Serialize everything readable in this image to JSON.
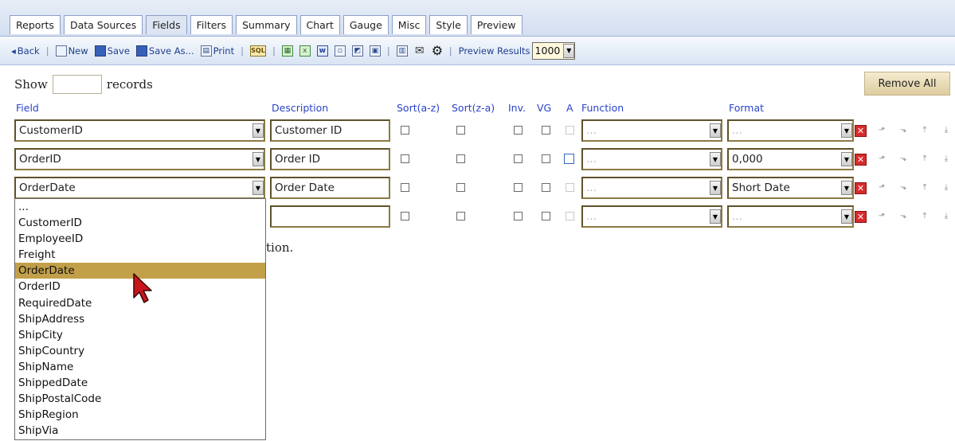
{
  "tabs": [
    "Reports",
    "Data Sources",
    "Fields",
    "Filters",
    "Summary",
    "Chart",
    "Gauge",
    "Misc",
    "Style",
    "Preview"
  ],
  "active_tab": "Fields",
  "toolbar": {
    "back": "Back",
    "new": "New",
    "save": "Save",
    "save_as": "Save As...",
    "print": "Print",
    "sql_icon": "SQL",
    "preview_results_label": "Preview Results",
    "preview_results_value": "1000"
  },
  "show": {
    "before": "Show",
    "after": "records",
    "value": ""
  },
  "remove_all": "Remove All",
  "headers": {
    "field": "Field",
    "description": "Description",
    "sort_az": "Sort(a-z)",
    "sort_za": "Sort(z-a)",
    "inv": "Inv.",
    "vg": "VG",
    "a": "A",
    "function": "Function",
    "format": "Format"
  },
  "rows": [
    {
      "field": "CustomerID",
      "description": "Customer ID",
      "function": "...",
      "format": "..."
    },
    {
      "field": "OrderID",
      "description": "Order ID",
      "function": "...",
      "format": "0,000"
    },
    {
      "field": "OrderDate",
      "description": "Order Date",
      "function": "...",
      "format": "Short Date"
    },
    {
      "field": "",
      "description": "",
      "function": "...",
      "format": "..."
    }
  ],
  "field_options": [
    "...",
    "CustomerID",
    "EmployeeID",
    "Freight",
    "OrderDate",
    "OrderID",
    "RequiredDate",
    "ShipAddress",
    "ShipCity",
    "ShipCountry",
    "ShipName",
    "ShippedDate",
    "ShipPostalCode",
    "ShipRegion",
    "ShipVia"
  ],
  "field_options_selected": "OrderDate",
  "partial_text": "tion.",
  "colors": {
    "accent_gold": "#c2a04a",
    "header_blue": "#2a43c8",
    "delete_red": "#d72b2b"
  }
}
